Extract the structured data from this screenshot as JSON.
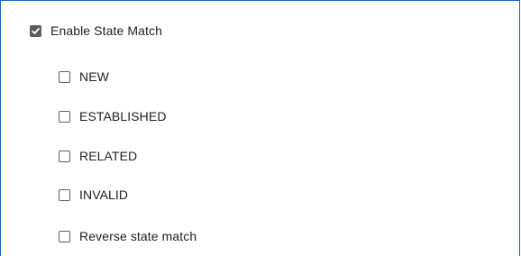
{
  "panel": {
    "enable_state_match": {
      "label": "Enable State Match",
      "checked": true,
      "icon": "check-icon"
    },
    "options": [
      {
        "label": "NEW",
        "checked": false
      },
      {
        "label": "ESTABLISHED",
        "checked": false
      },
      {
        "label": "RELATED",
        "checked": false
      },
      {
        "label": "INVALID",
        "checked": false
      },
      {
        "label": "Reverse state match",
        "checked": false
      }
    ]
  },
  "colors": {
    "border_accent": "#1a63c4",
    "checkbox_checked_fill": "#5c5c5c",
    "checkbox_border": "#5f5f5f",
    "text": "#222222"
  }
}
